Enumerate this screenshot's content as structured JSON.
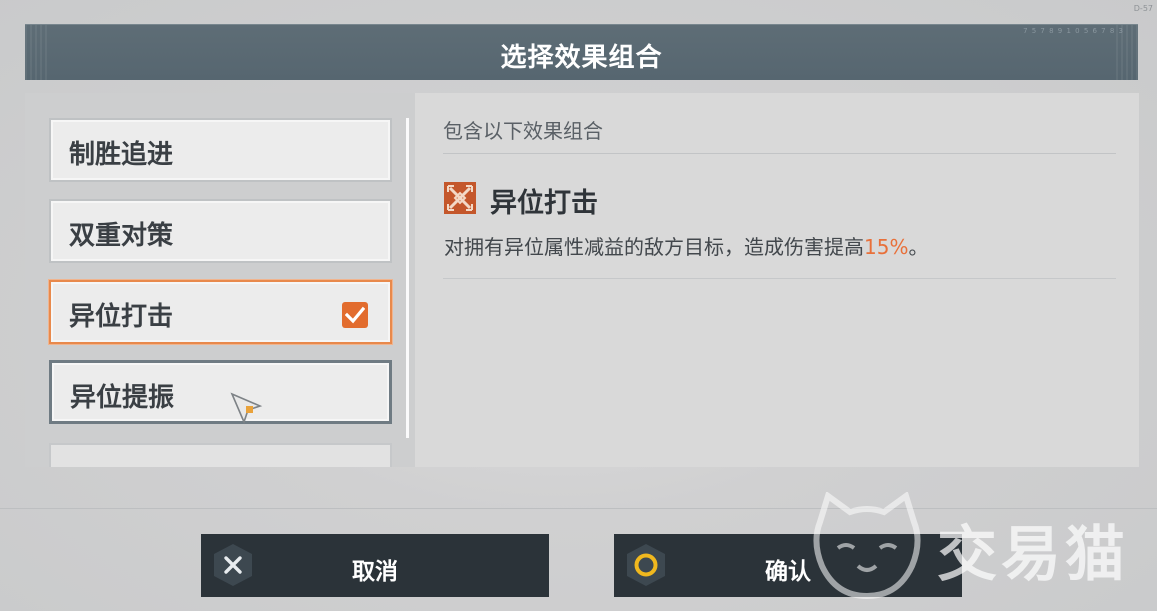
{
  "corner_code": "D-57",
  "header": {
    "title": "选择效果组合",
    "code": "7 5 7 8 9 1 0 5 6 7 8 3"
  },
  "list": {
    "items": [
      {
        "label": "制胜追进",
        "selected": false
      },
      {
        "label": "双重对策",
        "selected": false
      },
      {
        "label": "异位打击",
        "selected": true
      },
      {
        "label": "异位提振",
        "selected": false
      }
    ]
  },
  "detail": {
    "subtitle": "包含以下效果组合",
    "effect": {
      "icon": "crossed-swords-icon",
      "name": "异位打击",
      "desc_prefix": "对拥有异位属性减益的敌方目标，造成伤害提高",
      "desc_value": "15%",
      "desc_suffix": "。"
    }
  },
  "buttons": {
    "cancel": {
      "label": "取消",
      "icon": "close-icon"
    },
    "confirm": {
      "label": "确认",
      "icon": "circle-icon"
    }
  },
  "watermark": {
    "text": "交易猫"
  },
  "colors": {
    "accent": "#e26c2e",
    "header": "#5a6972",
    "button": "#2b3339",
    "confirm_ring": "#f0b81e"
  }
}
